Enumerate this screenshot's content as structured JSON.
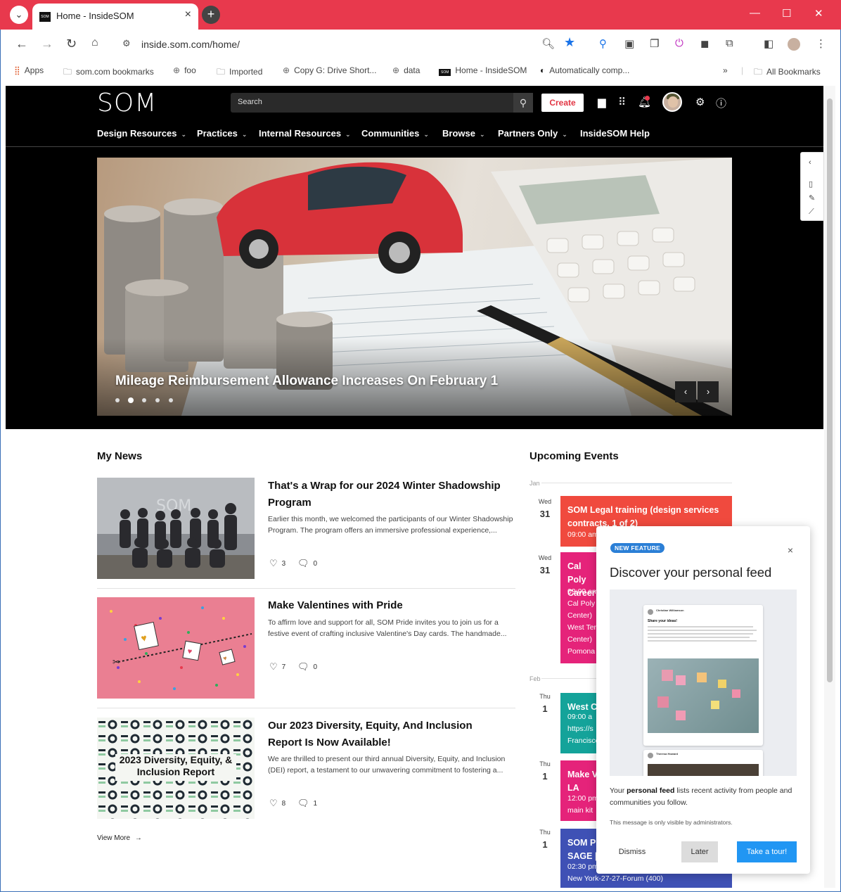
{
  "browser": {
    "tab_title": "Home - InsideSOM",
    "url": "inside.som.com/home/",
    "bookmarks": [
      {
        "label": "Apps",
        "icon": "apps-grid-icon"
      },
      {
        "label": "som.com bookmarks",
        "icon": "folder-icon"
      },
      {
        "label": "foo",
        "icon": "globe-icon"
      },
      {
        "label": "Imported",
        "icon": "folder-icon"
      },
      {
        "label": "Copy G: Drive Short...",
        "icon": "globe-icon"
      },
      {
        "label": "data",
        "icon": "globe-icon"
      },
      {
        "label": "Home - InsideSOM",
        "icon": "som-favicon"
      },
      {
        "label": "Automatically comp...",
        "icon": "bookmark-favicon"
      }
    ],
    "all_bookmarks": "All Bookmarks",
    "colors": {
      "tab_bar": "#e8394d",
      "star": "#1a73e8"
    }
  },
  "site": {
    "logo": "SOM",
    "search_placeholder": "Search",
    "create_label": "Create",
    "nav": [
      {
        "label": "Design Resources",
        "dropdown": true
      },
      {
        "label": "Practices",
        "dropdown": true
      },
      {
        "label": "Internal Resources",
        "dropdown": true
      },
      {
        "label": "Communities",
        "dropdown": true
      },
      {
        "label": "Browse",
        "dropdown": true
      },
      {
        "label": "Partners Only",
        "dropdown": true
      },
      {
        "label": "InsideSOM Help",
        "dropdown": false
      }
    ]
  },
  "hero": {
    "title": "Mileage Reimbursement Allowance Increases On February 1",
    "slide_count": 5,
    "active_slide": 2
  },
  "news": {
    "heading": "My News",
    "items": [
      {
        "title": "That's a Wrap for our 2024 Winter Shadowship Program",
        "excerpt": "Earlier this month, we welcomed the participants of our Winter Shadowship Program. The program offers an immersive professional experience,...",
        "likes": "3",
        "comments": "0"
      },
      {
        "title": "Make Valentines with Pride",
        "excerpt": "To affirm love and support for all, SOM Pride invites you to join us for a festive event of crafting inclusive Valentine's Day cards. The handmade...",
        "likes": "7",
        "comments": "0"
      },
      {
        "title": "Our 2023 Diversity, Equity, And Inclusion Report Is Now Available!",
        "excerpt": "We are thrilled to present our third annual Diversity, Equity, and Inclusion (DEI) report, a testament to our unwavering commitment to fostering a...",
        "likes": "8",
        "comments": "1",
        "image_text": "2023 Diversity, Equity, & Inclusion Report"
      }
    ],
    "view_more": "View More",
    "thumb_watermark": "SOM"
  },
  "events": {
    "heading": "Upcoming Events",
    "months": [
      "Jan",
      "Feb"
    ],
    "items": [
      {
        "day": "Wed",
        "date": "31",
        "title": "SOM Legal training (design services contracts, 1 of 2)",
        "details": [
          "09:00 am"
        ],
        "color": "#f04a3e"
      },
      {
        "day": "Wed",
        "date": "31",
        "title": "Cal Poly Career",
        "details": [
          "09:00 am",
          "Cal Poly",
          "Center)",
          "West Ter",
          "Center)",
          "Pomona"
        ],
        "color": "#e5237a"
      },
      {
        "day": "Thu",
        "date": "1",
        "title": "West C",
        "details": [
          "09:00 a",
          "https://s",
          "Francisco"
        ],
        "color": "#14a39a"
      },
      {
        "day": "Thu",
        "date": "1",
        "title": "Make V LA",
        "details": [
          "12:00 pm",
          "main kit"
        ],
        "color": "#e5237a"
      },
      {
        "day": "Thu",
        "date": "1",
        "title": "SOM Pr SAGE |",
        "details": [
          "02:30 pm",
          "New York-27-27-Forum (400)"
        ],
        "color": "#3f51b5"
      }
    ]
  },
  "popup": {
    "badge": "NEW FEATURE",
    "title": "Discover your personal feed",
    "body_pre": "Your ",
    "body_bold": "personal feed",
    "body_post": " lists recent activity from people and communities you follow.",
    "note": "This message is only visible by administrators.",
    "dismiss": "Dismiss",
    "later": "Later",
    "tour": "Take a tour!",
    "preview": {
      "post_heading": "Share your ideas!",
      "author_1": "Christian Williamson",
      "author_2": "Theresa Howard"
    }
  }
}
